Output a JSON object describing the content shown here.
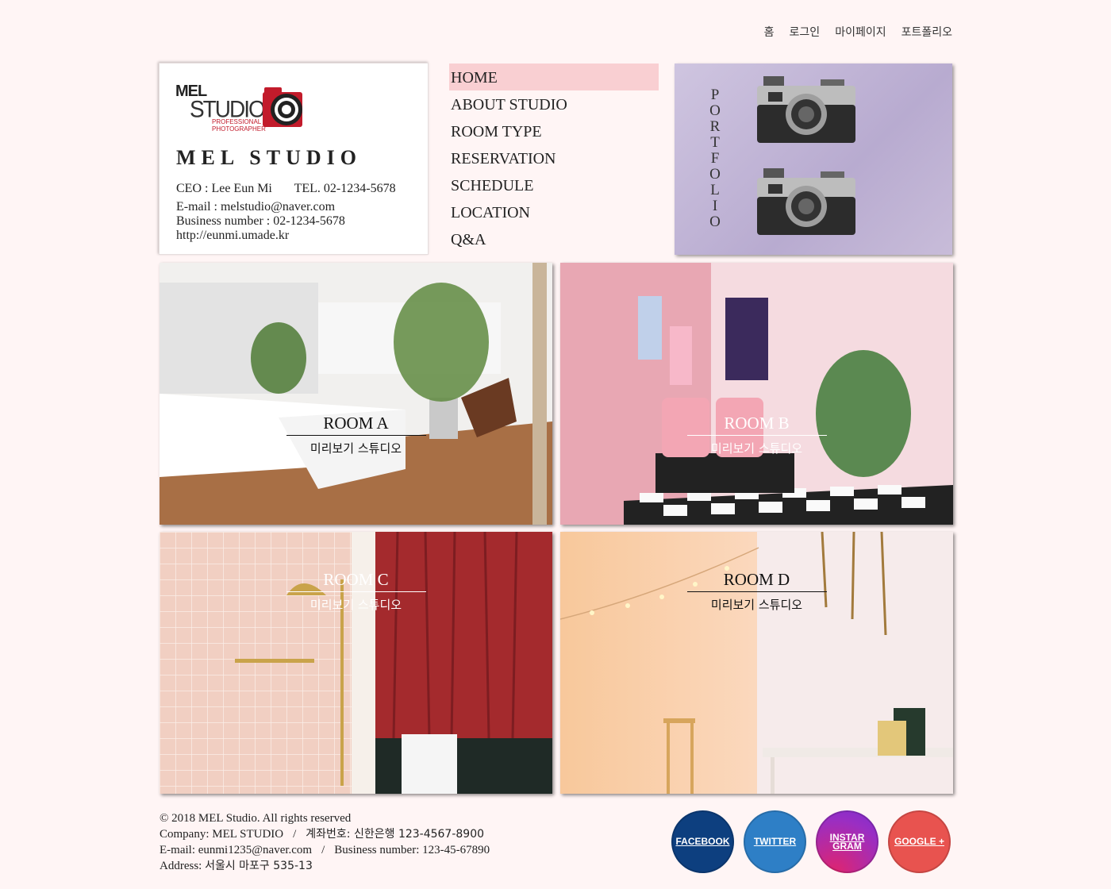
{
  "top_nav": [
    "홈",
    "로그인",
    "마이페이지",
    "포트폴리오"
  ],
  "logo": {
    "mel": "MEL",
    "studio": "STUDIO",
    "sub_line1": "PROFESSIONAL",
    "sub_line2": "PHOTOGRAPHER"
  },
  "card": {
    "title": "MEL STUDIO",
    "ceo": "CEO : Lee Eun Mi",
    "tel": "TEL. 02-1234-5678",
    "email": "E-mail : melstudio@naver.com",
    "business": "Business number : 02-1234-5678",
    "url": "http://eunmi.umade.kr"
  },
  "menu": {
    "active_index": 0,
    "items": [
      "HOME",
      "ABOUT STUDIO",
      "ROOM TYPE",
      "RESERVATION",
      "SCHEDULE",
      "LOCATION",
      "Q&A"
    ]
  },
  "portfolio": {
    "label": "PORTFOLIO"
  },
  "rooms": [
    {
      "name": "ROOM A",
      "sub": "미리보기 스튜디오"
    },
    {
      "name": "ROOM B",
      "sub": "미리보기 스튜디오"
    },
    {
      "name": "ROOM C",
      "sub": "미리보기 스튜디오"
    },
    {
      "name": "ROOM D",
      "sub": "미리보기 스튜디오"
    }
  ],
  "footer": {
    "copyright": "© 2018 MEL Studio. All rights reserved",
    "company": "Company: MEL STUDIO",
    "account": "계좌번호: 신한은행 123-4567-8900",
    "email": "E-mail: eunmi1235@naver.com",
    "business": "Business number: 123-45-67890",
    "address_label": "Address:",
    "address": "서울시 마포구 535-13"
  },
  "social": [
    {
      "label": "FACEBOOK",
      "icon": "facebook-icon",
      "color": "#0d3f7f"
    },
    {
      "label": "TWITTER",
      "icon": "twitter-icon",
      "color": "#2e7fc6"
    },
    {
      "label": "INSTAR GRAM",
      "icon": "instagram-icon",
      "color": "#9a2ec3"
    },
    {
      "label": "GOOGLE +",
      "icon": "google-plus-icon",
      "color": "#e8534f"
    }
  ],
  "colors": {
    "background": "#fff5f5",
    "menu_active": "#f9cfd2",
    "logo_red": "#c21b2b"
  }
}
